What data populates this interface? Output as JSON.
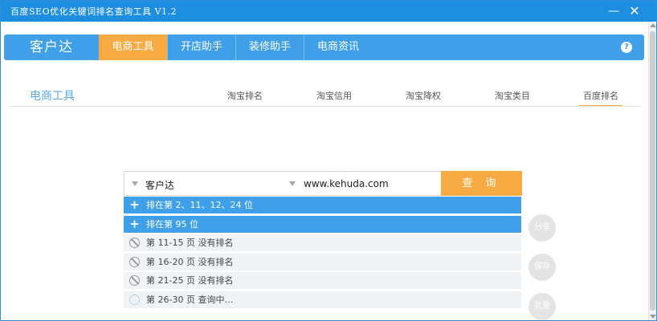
{
  "window": {
    "title": "百度SEO优化关键词排名查询工具 V1.2",
    "minimize_glyph": "—",
    "close_glyph": "✕"
  },
  "navbar": {
    "brand": "客户达",
    "tabs": [
      "电商工具",
      "开店助手",
      "装修助手",
      "电商资讯"
    ],
    "active_tab": "电商工具",
    "help_glyph": "?"
  },
  "section": {
    "title": "电商工具",
    "subtabs": [
      "淘宝排名",
      "淘宝信用",
      "淘宝降权",
      "淘宝类目",
      "百度排名"
    ],
    "active_subtab": "百度排名"
  },
  "search": {
    "keyword": "客户达",
    "site": "www.kehuda.com",
    "button_label": "查 询"
  },
  "results": [
    {
      "status": "found",
      "icon": "plus-icon",
      "text": "排在第 2、11、12、24 位"
    },
    {
      "status": "found",
      "icon": "plus-icon",
      "text": "排在第 95 位"
    },
    {
      "status": "none",
      "icon": "ban-icon",
      "text": "第 11-15 页 没有排名"
    },
    {
      "status": "none",
      "icon": "ban-icon",
      "text": "第 16-20 页 没有排名"
    },
    {
      "status": "none",
      "icon": "ban-icon",
      "text": "第 21-25 页 没有排名"
    },
    {
      "status": "loading",
      "icon": "spinner-icon",
      "text": "第 26-30 页 查询中…"
    }
  ],
  "side_buttons": [
    "分享",
    "保存",
    "批量"
  ],
  "colors": {
    "titlebar": "#1d8ee0",
    "nav": "#3f9fe8",
    "accent_orange": "#f7ab42",
    "section_title": "#5aa9e6"
  }
}
